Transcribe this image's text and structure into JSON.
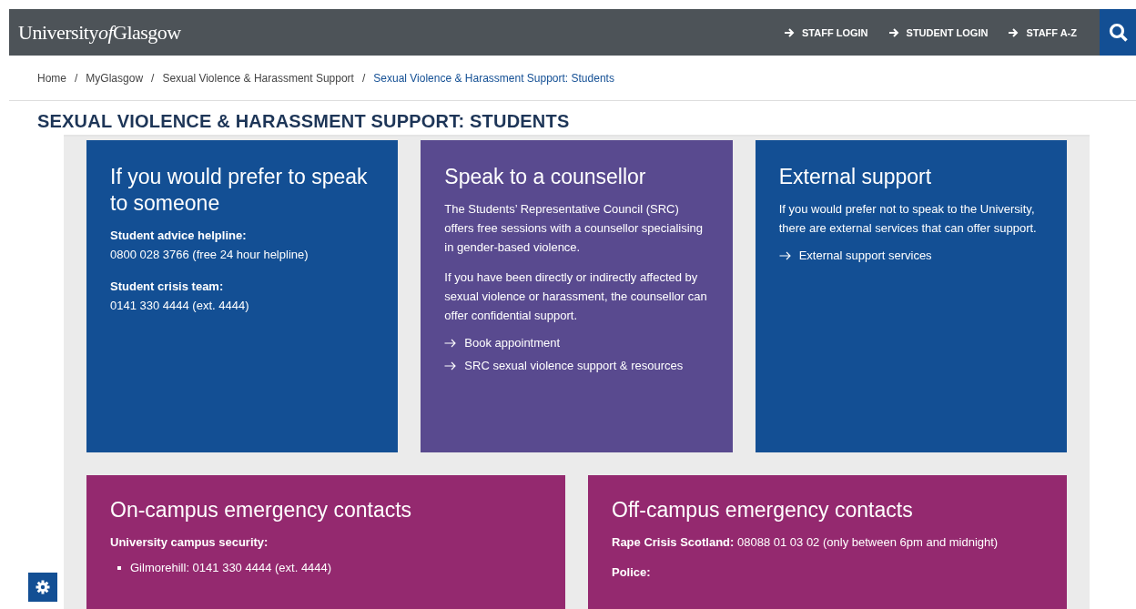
{
  "header": {
    "logo": [
      {
        "kind": "plain",
        "text": "University"
      },
      {
        "kind": "italic",
        "text": "of"
      },
      {
        "kind": "plain",
        "text": "Glasgow"
      }
    ],
    "nav": [
      "STAFF LOGIN",
      "STUDENT LOGIN",
      "STAFF A-Z"
    ]
  },
  "breadcrumb_separator": [
    "/",
    "/",
    "/"
  ],
  "breadcrumb": [
    {
      "label": "Home",
      "selected": false
    },
    {
      "label": "MyGlasgow",
      "selected": false
    },
    {
      "label": "Sexual Violence & Harassment Support",
      "selected": false
    },
    {
      "label": "Sexual Violence & Harassment Support: Students",
      "selected": true
    }
  ],
  "page_title": "SEXUAL VIOLENCE & HARASSMENT SUPPORT: STUDENTS",
  "card_rows": [
    {
      "cards": [
        {
          "title": "If you would prefer to speak to someone",
          "color": "#134f94",
          "blocks": [
            {
              "kind": "label",
              "text": "Student advice helpline:"
            },
            {
              "kind": "text",
              "text": "0800 028 3766 (free 24 hour helpline)"
            },
            {
              "kind": "label",
              "text": "Student crisis team:"
            },
            {
              "kind": "text",
              "text": "0141 330 4444 (ext. 4444)"
            }
          ]
        },
        {
          "title": "Speak to a counsellor",
          "color": "#594a8f",
          "blocks": [
            {
              "kind": "paragraph",
              "text": "The Students’ Representative Council (SRC) offers free sessions with a counsellor specialising in gender-based violence."
            },
            {
              "kind": "paragraph",
              "text": "If you have been directly or indirectly affected by sexual violence or harassment, the counsellor can offer confidential support."
            },
            {
              "kind": "link",
              "text": "Book appointment"
            },
            {
              "kind": "link",
              "text": "SRC sexual violence support & resources"
            }
          ]
        },
        {
          "title": "External support",
          "color": "#134f94",
          "blocks": [
            {
              "kind": "paragraph",
              "text": "If you would prefer not to speak to the University, there are external services that can offer support."
            },
            {
              "kind": "link",
              "text": "External support services"
            }
          ]
        }
      ]
    },
    {
      "cards": [
        {
          "title": "On-campus emergency contacts",
          "color": "#94296f",
          "blocks": [
            {
              "kind": "label",
              "text": "University campus security:"
            },
            {
              "kind": "bullet",
              "text": "Gilmorehill: 0141 330 4444 (ext. 4444)"
            }
          ]
        },
        {
          "title": "Off-campus emergency contacts",
          "color": "#94296f",
          "blocks": [
            {
              "kind": "paragraph",
              "text": "**Rape Crisis Scotland:** 08088 01 03 02 (only between 6pm and midnight)"
            },
            {
              "kind": "label",
              "text": "Police:"
            }
          ]
        }
      ]
    }
  ]
}
